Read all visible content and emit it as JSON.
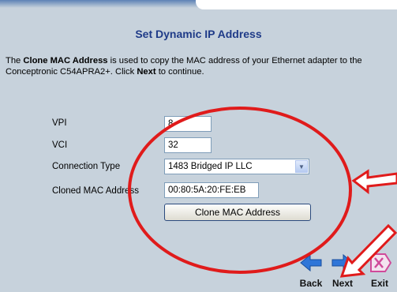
{
  "page": {
    "title": "Set Dynamic IP Address",
    "intro": {
      "part1": "The ",
      "bold1": "Clone MAC Address",
      "part2": " is used to copy the MAC address of your Ethernet adapter to the Conceptronic C54APRA2+. Click ",
      "bold2": "Next",
      "part3": " to continue."
    }
  },
  "form": {
    "vpi": {
      "label": "VPI",
      "value": "8"
    },
    "vci": {
      "label": "VCI",
      "value": "32"
    },
    "connection_type": {
      "label": "Connection Type",
      "selected": "1483 Bridged IP LLC"
    },
    "cloned_mac": {
      "label": "Cloned MAC Address",
      "value": "00:80:5A:20:FE:EB"
    },
    "clone_button_label": "Clone MAC Address"
  },
  "nav": {
    "back_label": "Back",
    "next_label": "Next",
    "exit_label": "Exit"
  },
  "colors": {
    "background": "#c7d2dc",
    "title": "#1f3b88",
    "annotation": "#e01b1b",
    "nav_arrow": "#2f76d8",
    "exit_icon": "#d04a9a"
  },
  "icons": [
    "back-arrow-icon",
    "next-arrow-icon",
    "exit-x-icon",
    "select-chevron-down-icon"
  ]
}
